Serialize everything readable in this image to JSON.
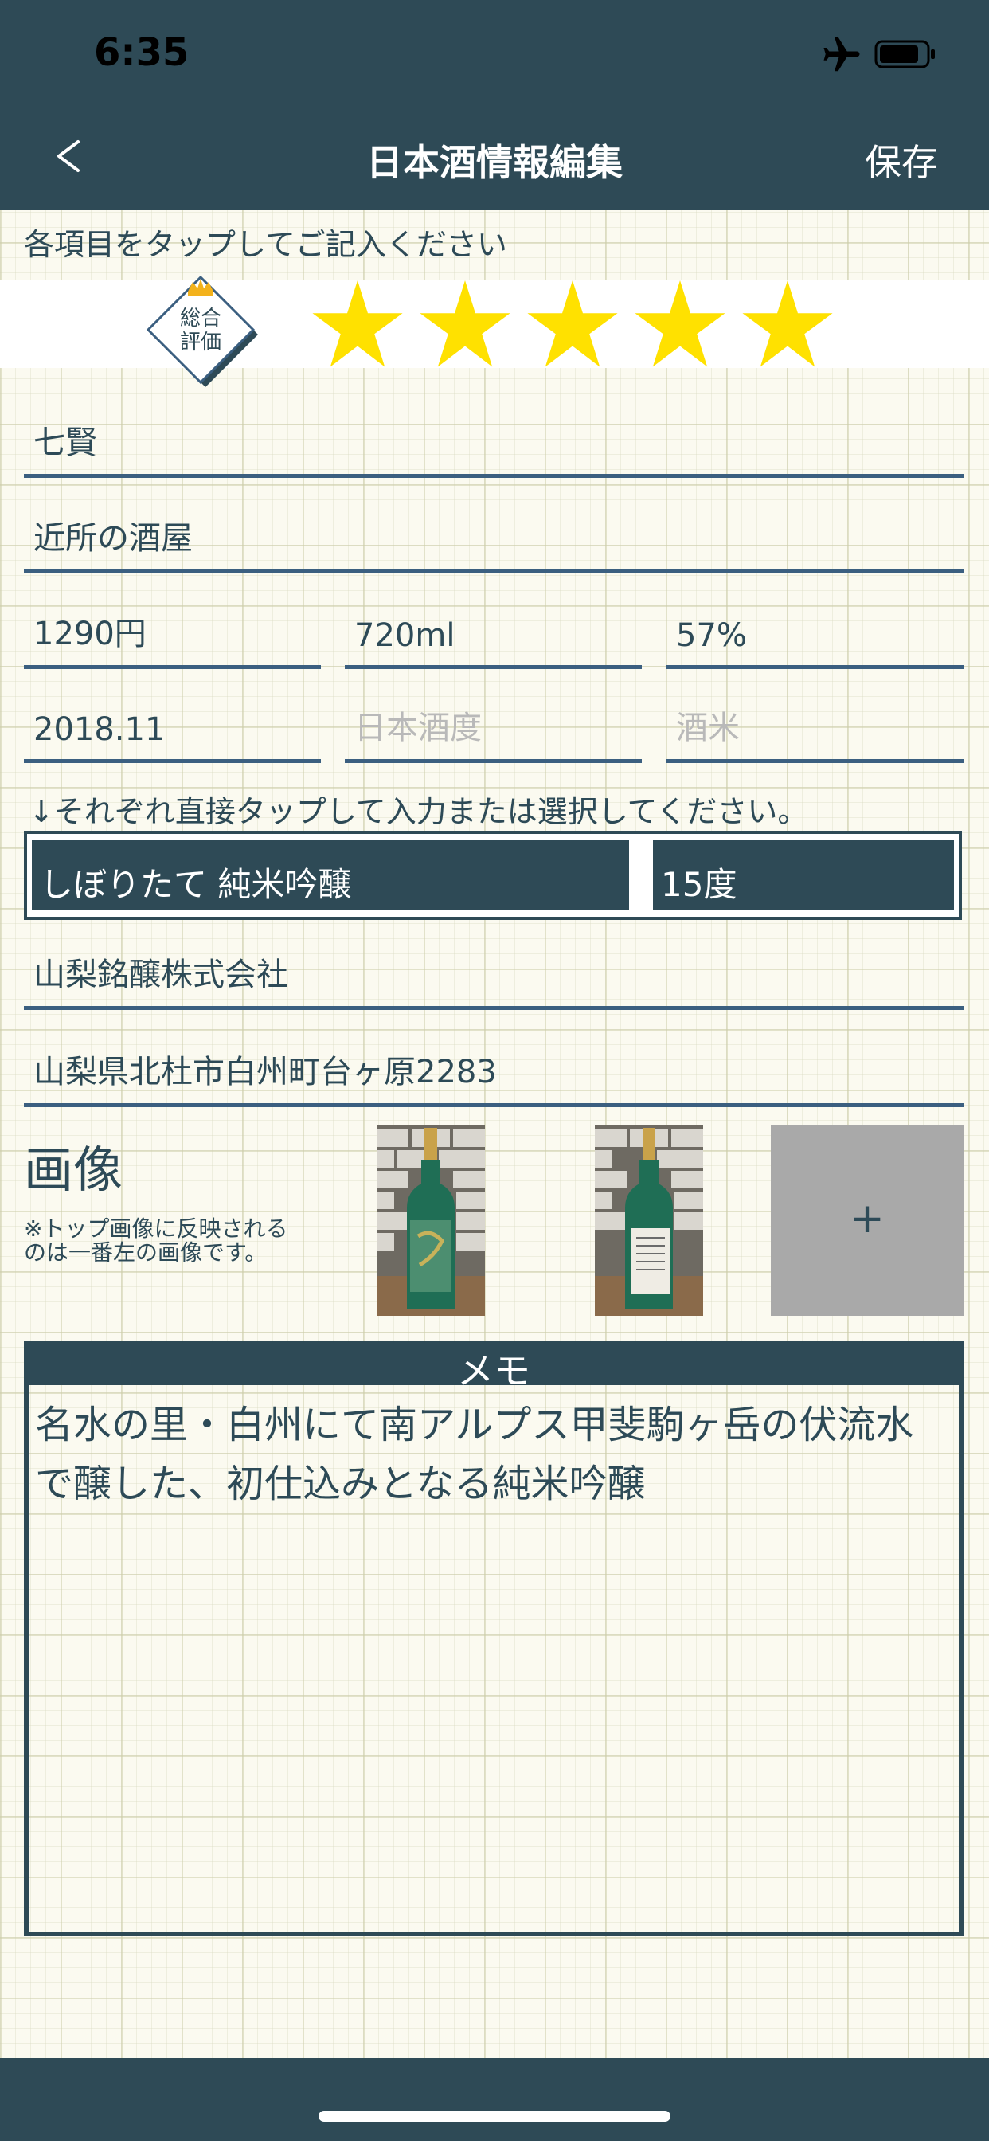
{
  "status_bar": {
    "time": "6:35"
  },
  "nav": {
    "back_label": "<",
    "title": "日本酒情報編集",
    "save_label": "保存"
  },
  "instruction_top": "各項目をタップしてご記入ください",
  "rating": {
    "badge_line1": "総合",
    "badge_line2": "評価",
    "stars_filled": 5,
    "stars_total": 5,
    "star_color": "#ffe100"
  },
  "fields": {
    "name": "七賢",
    "purchase_place": "近所の酒屋",
    "price": "1290円",
    "volume": "720ml",
    "polish_ratio": "57%",
    "date": "2018.11",
    "sake_meter_placeholder": "日本酒度",
    "rice_placeholder": "酒米"
  },
  "instruction_mid": "↓それぞれ直接タップして入力または選択してください。",
  "selectors": {
    "type": "しぼりたて 純米吟醸",
    "alcohol": "15度"
  },
  "brewery": {
    "name": "山梨銘醸株式会社",
    "address": "山梨県北杜市白州町台ヶ原2283"
  },
  "images": {
    "heading": "画像",
    "note": "※トップ画像に反映されるのは一番左の画像です。",
    "add_label": "+"
  },
  "memo": {
    "header": "メモ",
    "text": "名水の里・白州にて南アルプス甲斐駒ヶ岳の伏流水で醸した、初仕込みとなる純米吟醸"
  },
  "colors": {
    "primary": "#2e4a56",
    "field_underline": "#3b5f80",
    "star": "#ffe100",
    "add_tile": "#a9a9a9"
  }
}
